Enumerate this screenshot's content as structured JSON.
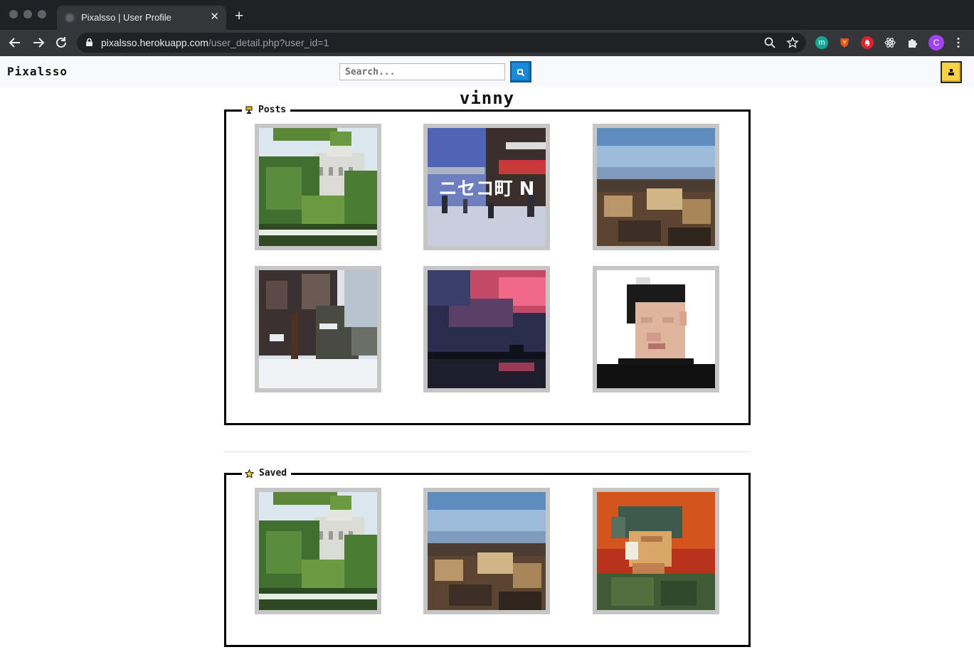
{
  "browser": {
    "tab_title": "Pixalsso | User Profile",
    "tab_close": "✕",
    "new_tab": "+",
    "url_host": "pixalsso.herokuapp.com",
    "url_path": "/user_detail.php?user_id=1",
    "profile_initial": "C",
    "ext_m_label": "m"
  },
  "app": {
    "brand": "Pixalsso",
    "search_placeholder": "Search...",
    "accent_color": "#1a8ad8",
    "user_button_color": "#f7d246"
  },
  "profile": {
    "username": "vinny"
  },
  "posts": {
    "label": "Posts",
    "icon": "trophy-icon",
    "items": [
      {
        "subject": "white-building-behind-trees"
      },
      {
        "subject": "snowy-street-with-sign",
        "sign_text": "ニセコ町 N"
      },
      {
        "subject": "autumn-bushes-under-blue-sky"
      },
      {
        "subject": "snowy-pine-trees"
      },
      {
        "subject": "pink-sunset-over-pier"
      },
      {
        "subject": "portrait-of-man"
      }
    ]
  },
  "saved": {
    "label": "Saved",
    "icon": "star-icon",
    "items": [
      {
        "subject": "white-building-behind-trees"
      },
      {
        "subject": "autumn-bushes-under-blue-sky"
      },
      {
        "subject": "van-gogh-self-portrait"
      }
    ]
  }
}
